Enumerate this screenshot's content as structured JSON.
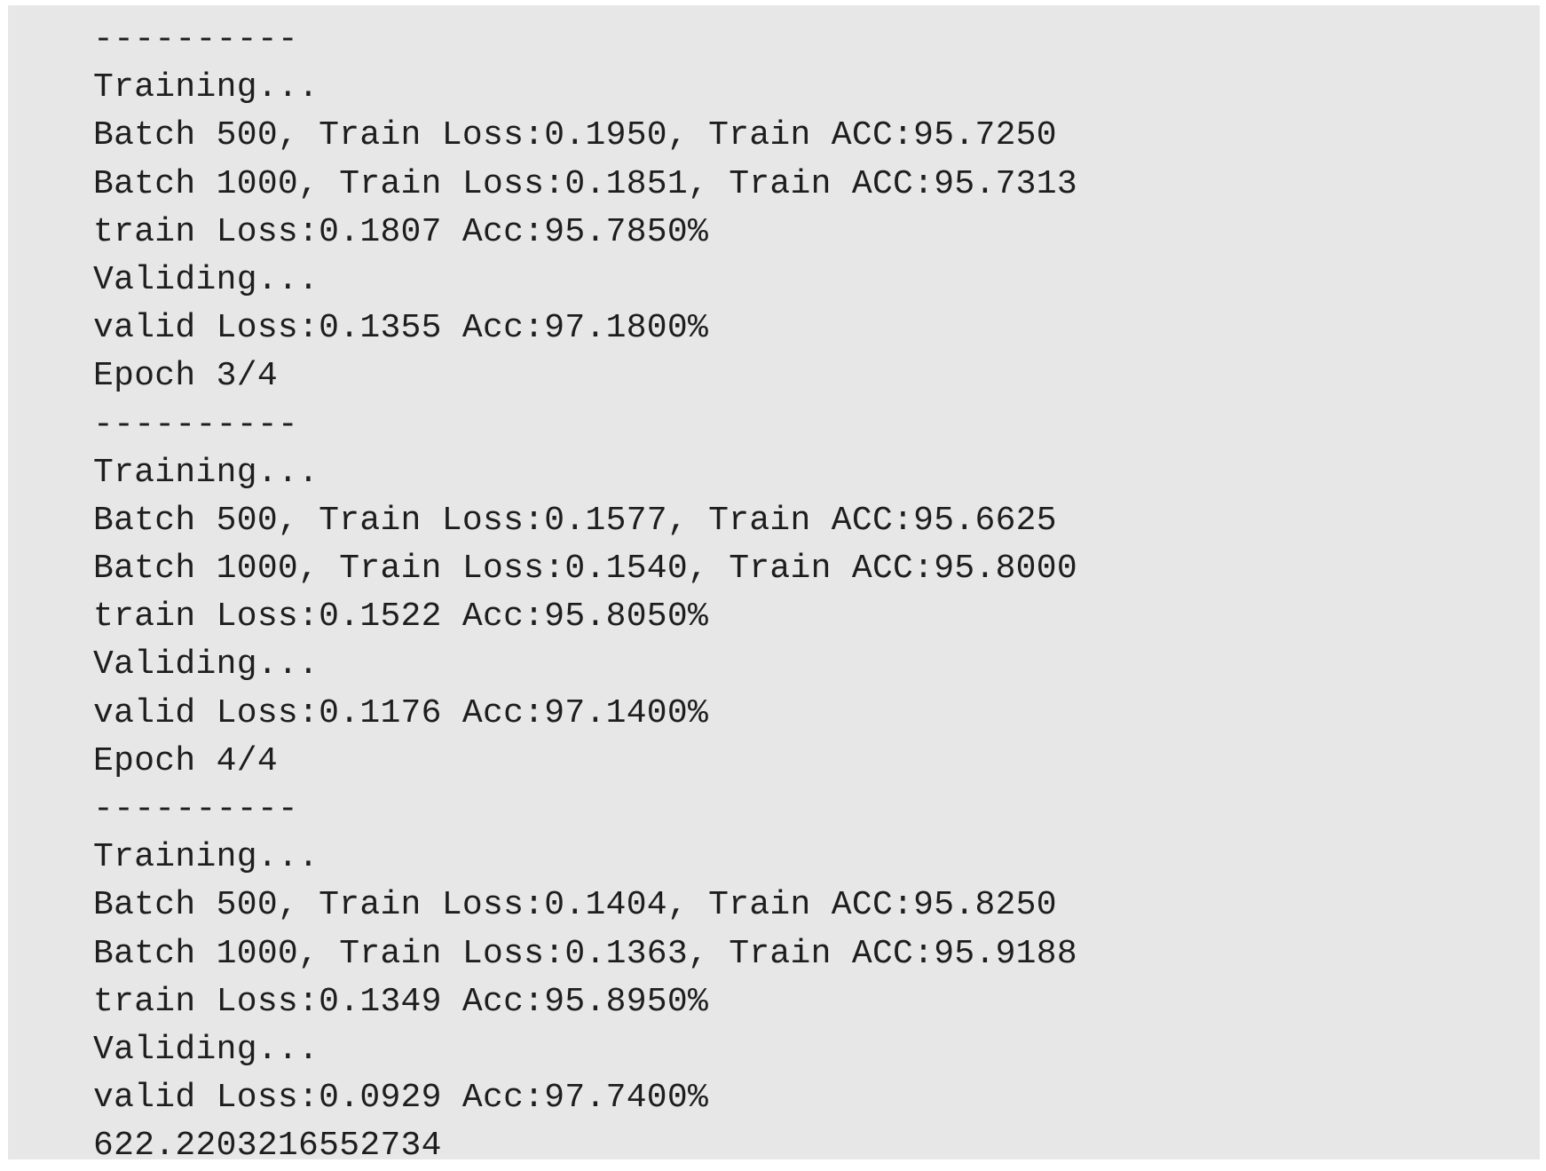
{
  "console": {
    "lines": [
      "----------",
      "Training...",
      "Batch 500, Train Loss:0.1950, Train ACC:95.7250",
      "Batch 1000, Train Loss:0.1851, Train ACC:95.7313",
      "train Loss:0.1807 Acc:95.7850%",
      "Validing...",
      "valid Loss:0.1355 Acc:97.1800%",
      "Epoch 3/4",
      "----------",
      "Training...",
      "Batch 500, Train Loss:0.1577, Train ACC:95.6625",
      "Batch 1000, Train Loss:0.1540, Train ACC:95.8000",
      "train Loss:0.1522 Acc:95.8050%",
      "Validing...",
      "valid Loss:0.1176 Acc:97.1400%",
      "Epoch 4/4",
      "----------",
      "Training...",
      "Batch 500, Train Loss:0.1404, Train ACC:95.8250",
      "Batch 1000, Train Loss:0.1363, Train ACC:95.9188",
      "train Loss:0.1349 Acc:95.8950%",
      "Validing...",
      "valid Loss:0.0929 Acc:97.7400%",
      "622.2203216552734"
    ]
  },
  "colors": {
    "background": "#e7e7e7",
    "text": "#1e1e1e"
  }
}
